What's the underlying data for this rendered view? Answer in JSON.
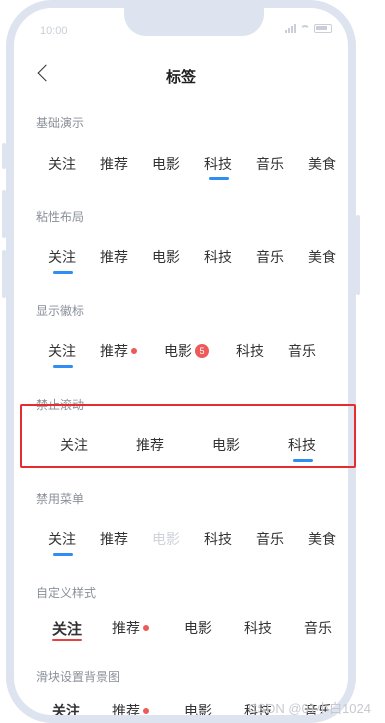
{
  "status": {
    "time": "10:00"
  },
  "header": {
    "title": "标签"
  },
  "sections": {
    "basic": {
      "label": "基础演示",
      "tabs": [
        "关注",
        "推荐",
        "电影",
        "科技",
        "音乐",
        "美食"
      ],
      "active_index": 3
    },
    "sticky": {
      "label": "粘性布局",
      "tabs": [
        "关注",
        "推荐",
        "电影",
        "科技",
        "音乐",
        "美食"
      ],
      "active_index": 0
    },
    "badges": {
      "label": "显示徽标",
      "tabs": [
        "关注",
        "推荐",
        "电影",
        "科技",
        "音乐"
      ],
      "badge_count": "5",
      "active_index": 0
    },
    "noscroll": {
      "label": "禁止滚动",
      "tabs": [
        "关注",
        "推荐",
        "电影",
        "科技"
      ],
      "active_index": 3
    },
    "disabled": {
      "label": "禁用菜单",
      "tabs": [
        "关注",
        "推荐",
        "电影",
        "科技",
        "音乐",
        "美食"
      ],
      "disabled_index": 2,
      "active_index": 0
    },
    "custom": {
      "label": "自定义样式",
      "tabs": [
        "关注",
        "推荐",
        "电影",
        "科技",
        "音乐"
      ],
      "active_index": 0
    },
    "bgimage": {
      "label": "滑块设置背景图",
      "tabs": [
        "关注",
        "推荐",
        "电影",
        "科技",
        "音乐"
      ]
    }
  },
  "watermark": "CSDN @01小白1024",
  "colors": {
    "accent": "#2f8ef4",
    "custom_accent": "#e64340",
    "badge": "#ee5a5a",
    "highlight": "#e52d2d"
  }
}
